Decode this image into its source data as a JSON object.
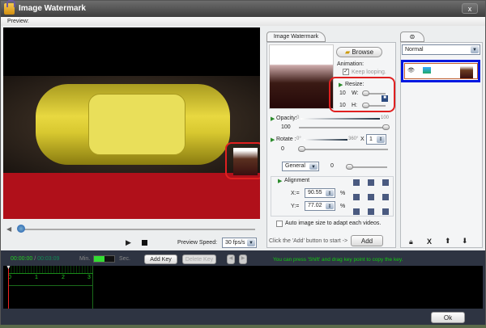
{
  "window": {
    "title": "Image Watermark",
    "close_label": "x",
    "menu": "Preview:"
  },
  "player": {
    "preview_speed_label": "Preview Speed:",
    "preview_speed_value": "30 fps/s",
    "seek_progress": 0.0
  },
  "watermark_panel": {
    "tab": "Image Watermark",
    "browse": "Browse",
    "animation_label": "Animation:",
    "keep_looping": "Keep looping.",
    "keep_looping_checked": true,
    "resize_label": "Resize:",
    "width_value": "10",
    "width_label": "W:",
    "height_value": "10",
    "height_label": "H:",
    "opacity_label": "Opacity:",
    "opacity_min": "0",
    "opacity_max": "100",
    "opacity_value": "100",
    "rotate_label": "Rotate :",
    "rotate_min": "0°",
    "rotate_max": "360°",
    "rotate_x": "X",
    "rotate_times": "1",
    "rotate_value": "0",
    "mode": "General",
    "mode_value": "0",
    "alignment_label": "Alignment",
    "x_label": "X:=",
    "x_value": "90.55",
    "y_label": "Y:=",
    "y_value": "77.02",
    "percent": "%",
    "auto_size": "Auto image size to adapt each videos.",
    "hint": "Click the 'Add' button to start ->",
    "add": "Add"
  },
  "layers": {
    "blend": "Normal"
  },
  "timeline": {
    "current": "00:00:00",
    "sep": "/",
    "total": "00:03:09",
    "min": "Min.",
    "sec": "Sec.",
    "add_key": "Add Key",
    "delete_key": "Delete Key",
    "hint": "You can press 'Shift' and drag key point to copy the key.",
    "ticks": [
      "0",
      "1",
      "2",
      "3"
    ]
  },
  "footer": {
    "ok": "Ok"
  }
}
